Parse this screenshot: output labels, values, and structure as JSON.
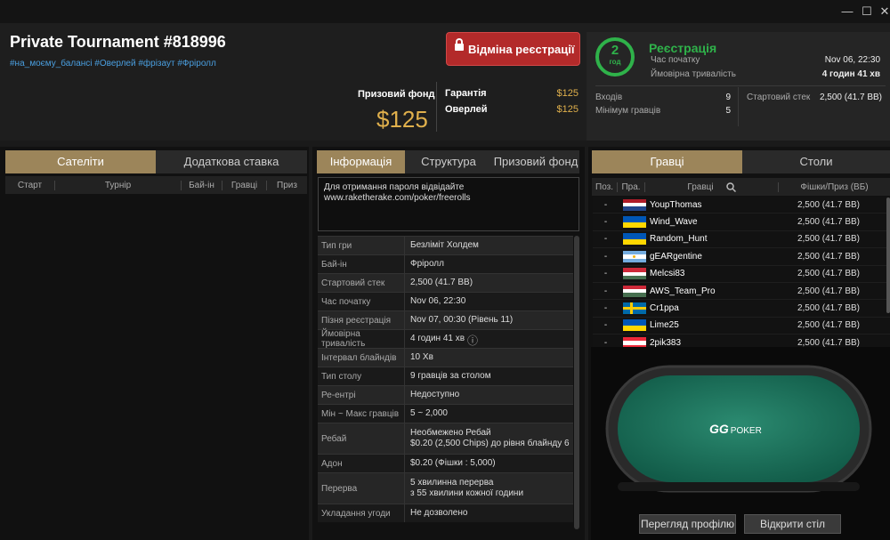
{
  "window": {
    "minimize": "—",
    "maximize": "☐",
    "close": "✕"
  },
  "tournament": {
    "title": "Private Tournament #818996",
    "tags": "#на_моєму_балансі #Оверлей #фрізаут #Фріролл",
    "unregister_label": "Відміна реєстрації",
    "prize_fund_label": "Призовий фонд",
    "prize_fund_value": "$125",
    "guarantee_label": "Гарантія",
    "guarantee_value": "$125",
    "overlay_label": "Оверлей",
    "overlay_value": "$125"
  },
  "registration": {
    "countdown_value": "2",
    "countdown_unit": "год",
    "title": "Реєстрація",
    "start_label": "Час початку",
    "start_value": "Nov 06, 22:30",
    "duration_label": "Ймовірна тривалість",
    "duration_value": "4 годин 41 хв",
    "entries_label": "Входів",
    "entries_value": "9",
    "min_players_label": "Мінімум гравців",
    "min_players_value": "5",
    "starting_stack_label": "Стартовий стек",
    "starting_stack_value": "2,500 (41.7 BB)"
  },
  "left_panel": {
    "tabs": [
      "Сателіти",
      "Додаткова ставка"
    ],
    "columns": [
      "Старт",
      "Турнір",
      "Бай-ін",
      "Гравці",
      "Приз"
    ]
  },
  "middle_panel": {
    "tabs": [
      "Інформація",
      "Структура",
      "Призовий фонд"
    ],
    "password_note_line1": "Для отримання пароля відвідайте",
    "password_note_line2": "www.raketherake.com/poker/freerolls",
    "rows": [
      {
        "k": "Тип гри",
        "v": "Безліміт Холдем"
      },
      {
        "k": "Бай-ін",
        "v": "Фріролл"
      },
      {
        "k": "Стартовий стек",
        "v": "2,500 (41.7 BB)"
      },
      {
        "k": "Час початку",
        "v": "Nov 06, 22:30"
      },
      {
        "k": "Пізня реєстрація",
        "v": "Nov 07, 00:30 (Рівень 11)"
      },
      {
        "k": "Ймовірна тривалість",
        "v": "4 годин 41 хв"
      },
      {
        "k": "Інтервал блайндів",
        "v": "10 Хв"
      },
      {
        "k": "Тип столу",
        "v": "9 гравців за столом"
      },
      {
        "k": "Ре-ентрі",
        "v": "Недоступно"
      },
      {
        "k": "Мін ~ Макс гравців",
        "v": "5 ~ 2,000"
      },
      {
        "k": "Ребай",
        "v": "Необмежено Ребай",
        "v2": "$0.20 (2,500 Chips) до рівня блайнду 6"
      },
      {
        "k": "Адон",
        "v": "$0.20 (Фішки : 5,000)"
      },
      {
        "k": "Перерва",
        "v": "5 хвилинна перерва",
        "v2": "з 55 хвилини кожної години"
      },
      {
        "k": "Укладання угоди",
        "v": "Не дозволено"
      }
    ]
  },
  "right_panel": {
    "tabs": [
      "Гравці",
      "Столи"
    ],
    "columns": [
      "Поз.",
      "Пра.",
      "Гравці",
      "Фішки/Приз (ВБ)"
    ],
    "players": [
      {
        "pos": "-",
        "flag": "nl",
        "name": "YoupThomas",
        "chips": "2,500 (41.7 BB)"
      },
      {
        "pos": "-",
        "flag": "ua",
        "name": "Wind_Wave",
        "chips": "2,500 (41.7 BB)"
      },
      {
        "pos": "-",
        "flag": "ua",
        "name": "Random_Hunt",
        "chips": "2,500 (41.7 BB)"
      },
      {
        "pos": "-",
        "flag": "ar",
        "name": "gEARgentine",
        "chips": "2,500 (41.7 BB)"
      },
      {
        "pos": "-",
        "flag": "hu",
        "name": "Melcsi83",
        "chips": "2,500 (41.7 BB)"
      },
      {
        "pos": "-",
        "flag": "hu",
        "name": "AWS_Team_Pro",
        "chips": "2,500 (41.7 BB)"
      },
      {
        "pos": "-",
        "flag": "se",
        "name": "Cr1ppa",
        "chips": "2,500 (41.7 BB)"
      },
      {
        "pos": "-",
        "flag": "ua",
        "name": "Lime25",
        "chips": "2,500 (41.7 BB)"
      },
      {
        "pos": "-",
        "flag": "at",
        "name": "2pik383",
        "chips": "2,500 (41.7 BB)"
      }
    ],
    "table_logo_gg": "GG",
    "table_logo_text": "POKER",
    "view_profile_label": "Перегляд профілю",
    "open_table_label": "Відкрити стіл"
  },
  "colors": {
    "accent_gold": "#9c855a",
    "prize_gold": "#e0b04c",
    "green": "#2fb24a",
    "unregister_red": "#b32a2a",
    "link_blue": "#4a9fe0"
  }
}
